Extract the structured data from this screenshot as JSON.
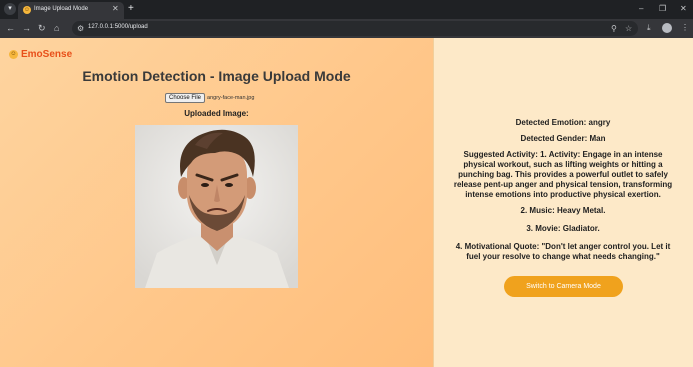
{
  "browser": {
    "tab_title": "Image Upload Mode",
    "new_tab_symbol": "+",
    "url": "127.0.0.1:5000/upload"
  },
  "app": {
    "brand_name": "EmoSense",
    "heading": "Emotion Detection - Image Upload Mode",
    "choose_file_label": "Choose File",
    "chosen_file_name": "angry-face-man.jpg",
    "uploaded_image_label": "Uploaded Image:"
  },
  "results": {
    "detected_emotion": "Detected Emotion: angry",
    "detected_gender": "Detected Gender: Man",
    "activity_lines": [
      "Suggested Activity: 1. Activity: Engage in an intense",
      "physical workout, such as lifting weights or hitting a",
      "punching bag. This provides a powerful outlet to safely",
      "release pent-up anger and physical tension, transforming",
      "intense emotions into productive physical exertion."
    ],
    "music": "2. Music: Heavy Metal.",
    "movie": "3. Movie: Gladiator.",
    "quote_lines": [
      "4. Motivational Quote: \"Don't let anger control you. Let it",
      "fuel your resolve to change what needs changing.\""
    ],
    "switch_button_label": "Switch to Camera Mode"
  },
  "colors": {
    "brand": "#e8501a",
    "button": "#f0a21d",
    "left_panel": "#ffc78a",
    "right_panel": "#fde9c8"
  },
  "icons": [
    "tab-list-icon",
    "favicon-icon",
    "close-icon",
    "back-icon",
    "forward-icon",
    "reload-icon",
    "home-icon",
    "site-info-icon",
    "zoom-icon",
    "bookmark-star-icon",
    "download-icon",
    "profile-avatar",
    "menu-icon",
    "minimize-icon",
    "maximize-icon",
    "window-close-icon"
  ]
}
